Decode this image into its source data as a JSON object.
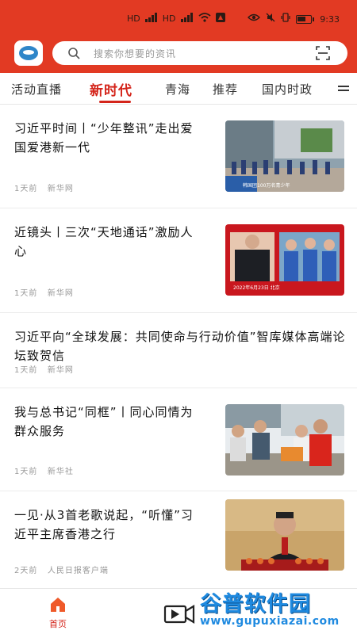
{
  "status_bar": {
    "left_indicators": [
      "HD",
      "5G",
      "HD",
      "5G",
      "wifi"
    ],
    "battery_percent": 66,
    "time": "9:33"
  },
  "search": {
    "placeholder": "搜索你想要的资讯"
  },
  "tabs": [
    {
      "label": "活动直播",
      "active": false
    },
    {
      "label": "新时代",
      "active": true
    },
    {
      "label": "青海",
      "active": false
    },
    {
      "label": "推荐",
      "active": false
    },
    {
      "label": "国内时政",
      "active": false
    }
  ],
  "feed": [
    {
      "title": "习近平时间丨“少年整讯”走出爱国爱港新一代",
      "time": "1天前",
      "source": "新华网",
      "has_image": true,
      "image_caption": "韩国团100万名青少年"
    },
    {
      "title": "近镜头丨三次“天地通话”激励人心",
      "time": "1天前",
      "source": "新华网",
      "has_image": true,
      "image_caption": "2022年6月23日 北京"
    },
    {
      "title": "习近平向“全球发展：共同使命与行动价值”智库媒体高端论坛致贺信",
      "time": "1天前",
      "source": "新华网",
      "has_image": false
    },
    {
      "title": "我与总书记“同框”丨同心同情为群众服务",
      "time": "1天前",
      "source": "新华社",
      "has_image": true
    },
    {
      "title": "一见·从3首老歌说起，“听懂”习近平主席香港之行",
      "time": "2天前",
      "source": "人民日报客户端",
      "has_image": true
    }
  ],
  "bottom_nav": {
    "home_label": "首页"
  },
  "watermark": {
    "title": "谷普软件园",
    "url": "www.gupuxiazai.com"
  },
  "colors": {
    "header_red": "#e23a23",
    "accent_red": "#d4251b",
    "watermark_blue": "#1f8ae0"
  }
}
